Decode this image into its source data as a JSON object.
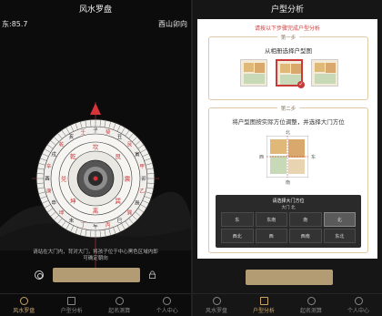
{
  "left": {
    "title": "风水罗盘",
    "heading": "东:85.7",
    "mountain": "酉山卯向",
    "hint": "请站在大门内，背对大门，将孩子位于中心黑色区域内即可确定朝向",
    "compass": {
      "ring_outer": [
        "乾",
        "亥",
        "壬",
        "子",
        "癸",
        "丑",
        "艮",
        "寅",
        "甲",
        "卯",
        "乙",
        "辰",
        "巽",
        "巳",
        "丙",
        "午",
        "丁",
        "未",
        "坤",
        "申",
        "庚",
        "酉",
        "辛",
        "戌"
      ],
      "ring_mid": [
        "乾",
        "坎",
        "艮",
        "震",
        "巽",
        "离",
        "坤",
        "兑"
      ]
    }
  },
  "right": {
    "title": "户型分析",
    "notice": "请按以下步骤完成户型分析",
    "step1": {
      "label": "第一步",
      "title": "从相册选择户型图"
    },
    "step2": {
      "label": "第二步",
      "title": "将户型图按实际方位调整，并选择大门方位"
    },
    "directions": {
      "n": "北",
      "s": "南",
      "e": "东",
      "w": "西"
    },
    "panel": {
      "title": "请选择大门方位",
      "subtitle": "大门 北",
      "cells": [
        "东",
        "东南",
        "南",
        "北",
        "西北",
        "西",
        "西南",
        "东北"
      ]
    }
  },
  "tabs": [
    {
      "label": "风水罗盘"
    },
    {
      "label": "户型分析"
    },
    {
      "label": "起名测算"
    },
    {
      "label": "个人中心"
    }
  ],
  "colors": {
    "accent": "#caa56a",
    "gold_button": "#b39b73",
    "red": "#c83a3a"
  }
}
